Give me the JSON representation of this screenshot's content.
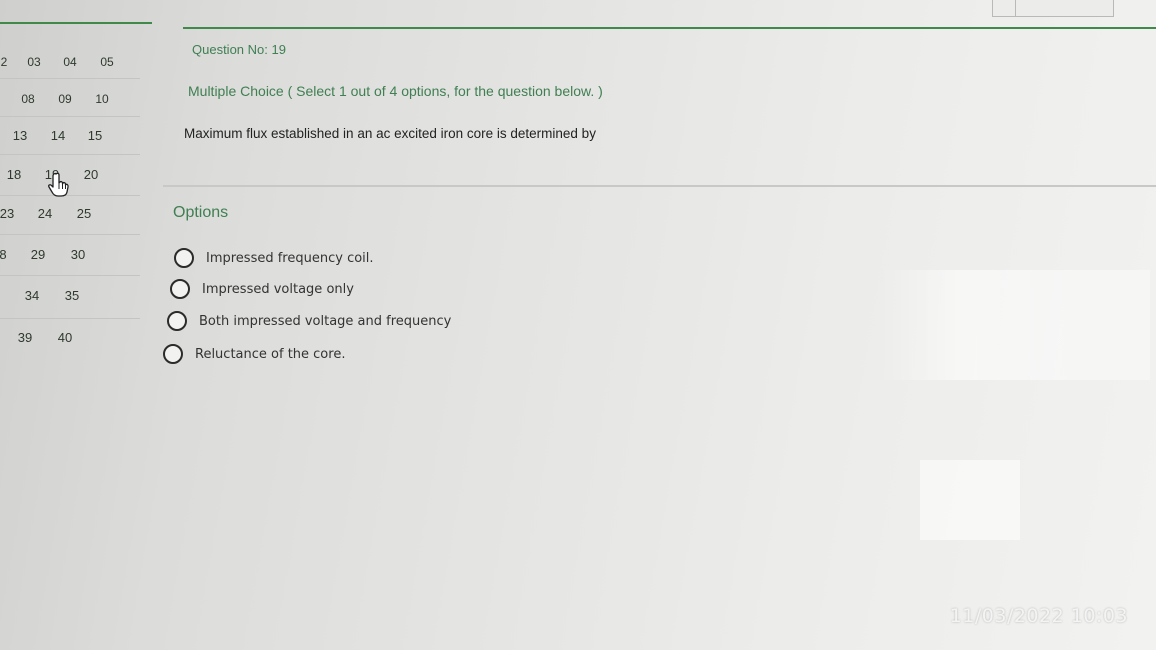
{
  "navigator": {
    "rows": [
      [
        "2",
        "03",
        "04",
        "05"
      ],
      [
        "08",
        "09",
        "10"
      ],
      [
        "13",
        "14",
        "15"
      ],
      [
        "18",
        "19",
        "20"
      ],
      [
        "23",
        "24",
        "25"
      ],
      [
        "8",
        "29",
        "30"
      ],
      [
        "34",
        "35"
      ],
      [
        "39",
        "40"
      ]
    ]
  },
  "question": {
    "number_label": "Question No: 19",
    "type_label": "Multiple Choice ( Select 1 out of 4 options, for the question below. )",
    "text": "Maximum flux established in an ac excited iron core is determined by"
  },
  "options": {
    "title": "Options",
    "items": [
      "Impressed frequency coil.",
      "Impressed voltage only",
      "Both impressed voltage and frequency",
      "Reluctance of the core."
    ]
  },
  "timestamp": "11/03/2022 10:03",
  "colors": {
    "accent_green": "#3f8a4a",
    "label_green": "#3f7f52"
  }
}
